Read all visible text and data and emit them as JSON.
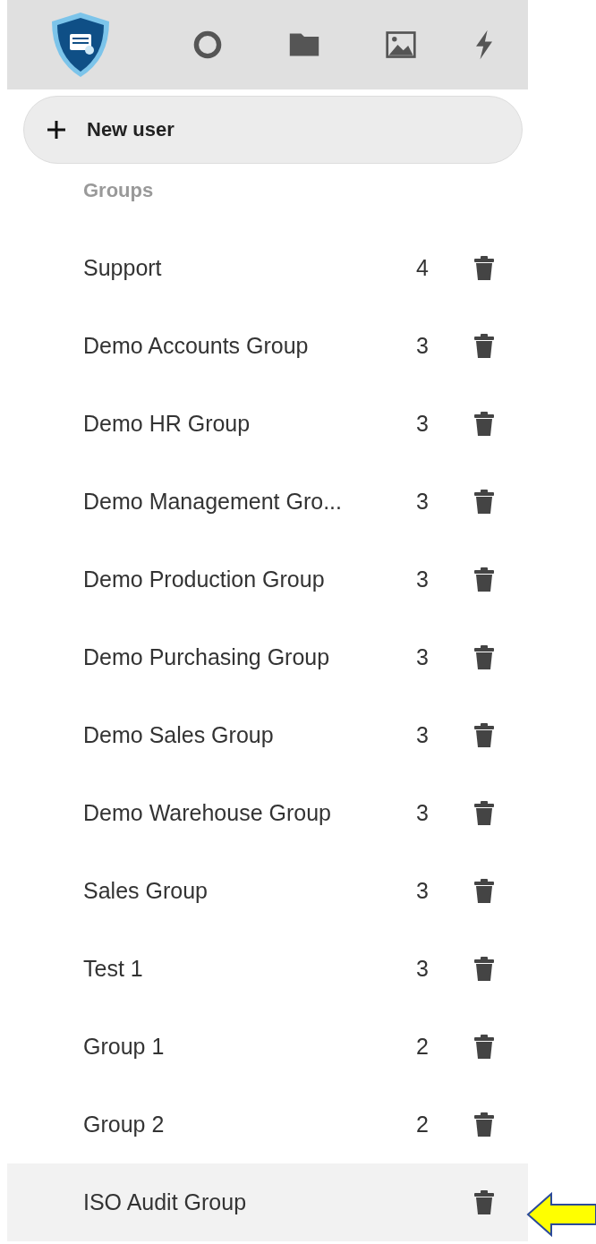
{
  "new_user_button": {
    "label": "New user"
  },
  "groups_heading": "Groups",
  "groups": [
    {
      "name": "Support",
      "count": "4",
      "highlighted": false
    },
    {
      "name": "Demo Accounts Group",
      "count": "3",
      "highlighted": false
    },
    {
      "name": "Demo HR Group",
      "count": "3",
      "highlighted": false
    },
    {
      "name": "Demo Management Gro...",
      "count": "3",
      "highlighted": false
    },
    {
      "name": "Demo Production Group",
      "count": "3",
      "highlighted": false
    },
    {
      "name": "Demo Purchasing Group",
      "count": "3",
      "highlighted": false
    },
    {
      "name": "Demo Sales Group",
      "count": "3",
      "highlighted": false
    },
    {
      "name": "Demo Warehouse Group",
      "count": "3",
      "highlighted": false
    },
    {
      "name": "Sales Group",
      "count": "3",
      "highlighted": false
    },
    {
      "name": "Test 1",
      "count": "3",
      "highlighted": false
    },
    {
      "name": "Group 1",
      "count": "2",
      "highlighted": false
    },
    {
      "name": "Group 2",
      "count": "2",
      "highlighted": false
    },
    {
      "name": "ISO Audit Group",
      "highlighted": true
    }
  ]
}
